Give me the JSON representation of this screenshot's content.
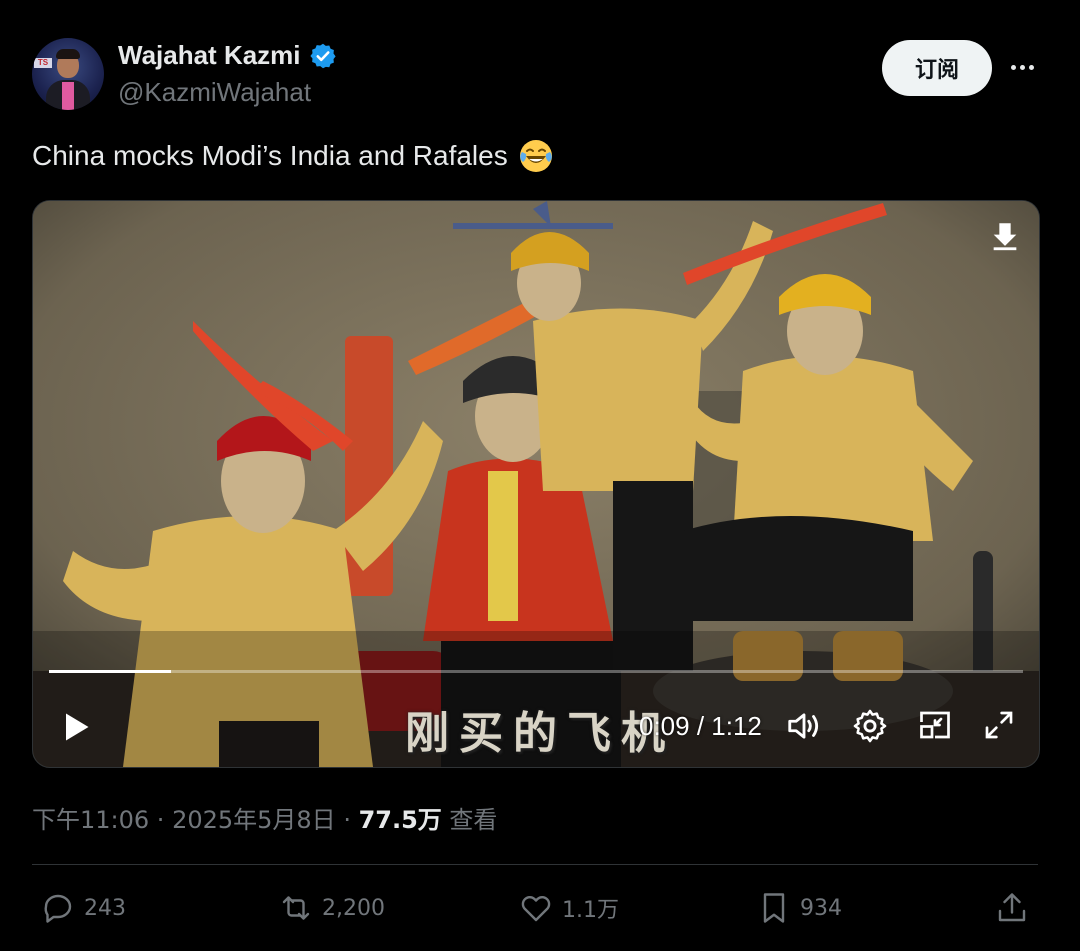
{
  "author": {
    "name": "Wajahat Kazmi",
    "handle": "@KazmiWajahat",
    "avatar_icon": "avatar-photo",
    "verified_color": "#1d9bf0"
  },
  "header": {
    "subscribe_label": "订阅",
    "more_icon": "more-dots-icon"
  },
  "tweet": {
    "text": "China mocks Modi’s India and Rafales",
    "emoji": "face-with-tears-of-joy"
  },
  "video": {
    "subtitle": "刚买的飞机",
    "time": "0:09 / 1:12",
    "progress": 0.125,
    "controls": [
      "play-icon",
      "volume-icon",
      "settings-icon",
      "pip-icon",
      "fullscreen-icon"
    ],
    "download_icon": "download-icon"
  },
  "meta": {
    "time": "下午11:06",
    "sep1": " · ",
    "date": "2025年5月8日",
    "sep2": " · ",
    "views_count": "77.5万",
    "views_label": " 查看"
  },
  "actions": {
    "replies": "243",
    "reposts": "2,200",
    "likes": "1.1万",
    "bookmarks": "934"
  },
  "colors": {
    "background": "#000000",
    "text_primary": "#e7e9ea",
    "text_secondary": "#71767b",
    "divider": "#2f3336"
  }
}
